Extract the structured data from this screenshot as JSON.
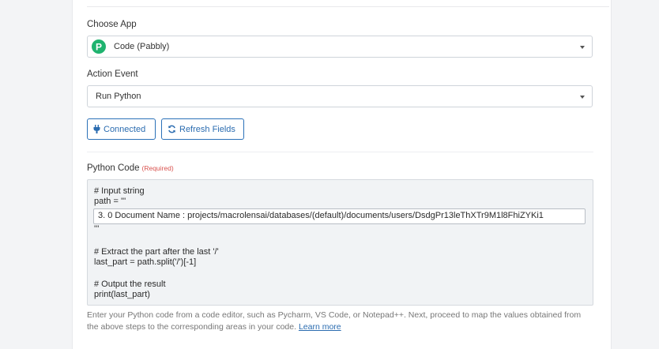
{
  "choose_app": {
    "label": "Choose App",
    "selected": "Code (Pabbly)",
    "logo_color": "#1fb36f"
  },
  "action_event": {
    "label": "Action Event",
    "selected": "Run Python"
  },
  "buttons": {
    "connected": "Connected",
    "refresh": "Refresh Fields",
    "accent": "#2b6cb0"
  },
  "python_code": {
    "label": "Python Code",
    "required": "(Required)",
    "lines": [
      "# Input string",
      "path = '''",
      "'''",
      "# Extract the part after the last '/'",
      "last_part = path.split('/')[-1]",
      "# Output the result",
      "print(last_part)"
    ],
    "inline_value": "3. 0 Document Name : projects/macrolensai/databases/(default)/documents/users/DsdgPr13leThXTr9M1l8FhiZYKi1"
  },
  "help": {
    "text": "Enter your Python code from a code editor, such as Pycharm, VS Code, or Notepad++. Next, proceed to map the values obtained from the above steps to the corresponding areas in your code.",
    "link": "Learn more"
  }
}
